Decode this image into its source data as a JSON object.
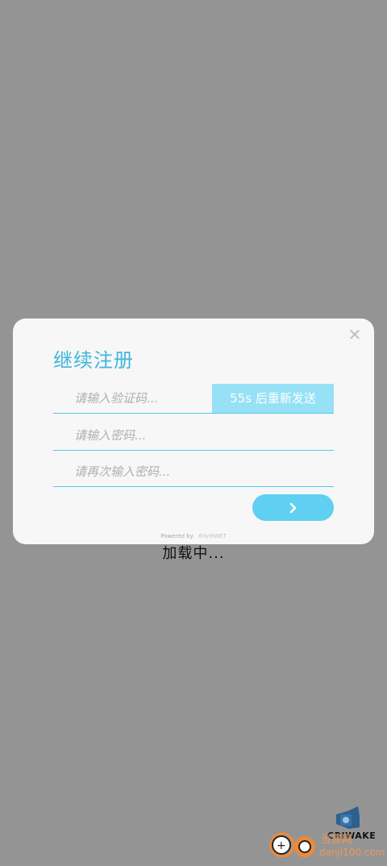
{
  "dialog": {
    "title": "继续注册",
    "close_icon": "close-icon",
    "verification_placeholder": "请输入验证码...",
    "resend_label": "55s 后重新发送",
    "password_placeholder": "请输入密码...",
    "confirm_placeholder": "请再次输入密码...",
    "next_icon": "chevron-right-icon",
    "powered_label": "Powered by",
    "powered_brand": "RhythNET"
  },
  "loading_text": "加载中...",
  "watermark": {
    "label": "CRIWAKE",
    "site_name": "当游网",
    "url": "danji100.com"
  },
  "colors": {
    "accent": "#5fd0f1",
    "title": "#3fb6dc",
    "backdrop": "#949494"
  }
}
